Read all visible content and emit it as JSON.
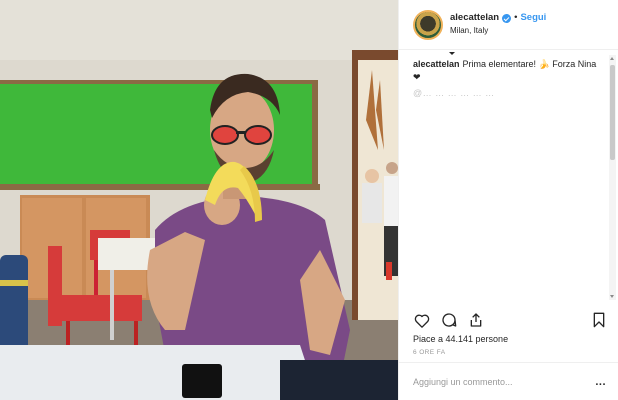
{
  "post": {
    "username": "alecattelan",
    "dot": "•",
    "follow_label": "Segui",
    "location": "Milan, Italy",
    "caption_text": "Prima elementare! 🍌 Forza Nina❤",
    "faded_text": "@… … … … … …",
    "likes_text": "Piace a 44.141 persone",
    "time_text": "6 ORE FA",
    "comment_placeholder": "Aggiungi un commento...",
    "more_label": "..."
  },
  "icons": {
    "like": "heart-icon",
    "comment": "comment-icon",
    "share": "share-icon",
    "save": "bookmark-icon",
    "verified": "verified-badge-icon"
  },
  "colors": {
    "accent": "#3897f0",
    "text": "#262626",
    "muted": "#999999",
    "chalkboard": "#3fb83a"
  }
}
